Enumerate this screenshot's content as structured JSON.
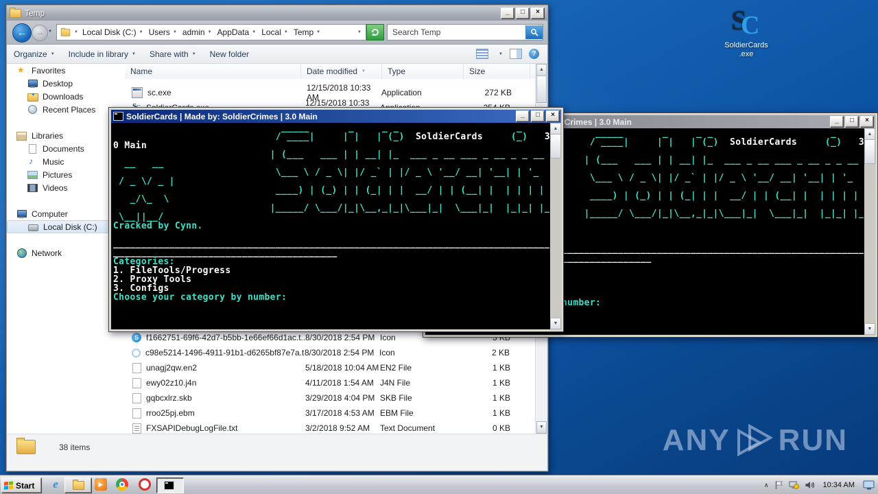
{
  "chrome": {
    "minimize": "_",
    "maximize": "□",
    "close": "×"
  },
  "desktop": {
    "icon": {
      "line1": "SoldierCards",
      "line2": ".exe",
      "logo_s": "S",
      "logo_c": "C"
    },
    "watermark": {
      "left": "ANY",
      "right": "RUN"
    }
  },
  "explorer": {
    "title": "Temp",
    "nav": {
      "back": "←",
      "forward": "→",
      "dropdown": "▼",
      "search_placeholder": "Search Temp"
    },
    "breadcrumb": [
      {
        "label": "Local Disk (C:)",
        "sep": "▼"
      },
      {
        "label": "Users",
        "sep": "▼"
      },
      {
        "label": "admin",
        "sep": "▼"
      },
      {
        "label": "AppData",
        "sep": "▼"
      },
      {
        "label": "Local",
        "sep": "▼"
      },
      {
        "label": "Temp",
        "sep": "▼"
      }
    ],
    "toolbar": [
      {
        "label": "Organize",
        "caret": "▼"
      },
      {
        "label": "Include in library",
        "caret": "▼"
      },
      {
        "label": "Share with",
        "caret": "▼"
      },
      {
        "label": "New folder",
        "caret": ""
      }
    ],
    "columns": [
      {
        "label": "Name",
        "sort": "",
        "cls": "c-name"
      },
      {
        "label": "Date modified",
        "sort": "▼",
        "cls": "c-date"
      },
      {
        "label": "Type",
        "sort": "",
        "cls": "c-type"
      },
      {
        "label": "Size",
        "sort": "",
        "cls": "c-size"
      }
    ],
    "sidebar": [
      {
        "label": "Favorites",
        "icon": "s-star",
        "lv": "lv0",
        "gap": ""
      },
      {
        "label": "Desktop",
        "icon": "s-monitor",
        "lv": "lv1",
        "gap": ""
      },
      {
        "label": "Downloads",
        "icon": "s-down",
        "lv": "lv1",
        "gap": ""
      },
      {
        "label": "Recent Places",
        "icon": "s-recent",
        "lv": "lv1",
        "gap": ""
      },
      {
        "label": "Libraries",
        "icon": "s-lib",
        "lv": "lv0",
        "gap": "gap"
      },
      {
        "label": "Documents",
        "icon": "s-doc",
        "lv": "lv1",
        "gap": ""
      },
      {
        "label": "Music",
        "icon": "s-music",
        "lv": "lv1",
        "gap": ""
      },
      {
        "label": "Pictures",
        "icon": "s-pic",
        "lv": "lv1",
        "gap": ""
      },
      {
        "label": "Videos",
        "icon": "s-video",
        "lv": "lv1",
        "gap": ""
      },
      {
        "label": "Computer",
        "icon": "s-computer",
        "lv": "lv0",
        "gap": "gap"
      },
      {
        "label": "Local Disk (C:)",
        "icon": "s-disk",
        "lv": "lv1",
        "gap": "",
        "sel": true
      },
      {
        "label": "Network",
        "icon": "s-network",
        "lv": "lv0",
        "gap": "gap"
      }
    ],
    "files_top": [
      {
        "icon": "i-app",
        "name": "sc.exe",
        "date": "12/15/2018 10:33 AM",
        "type": "Application",
        "size": "272 KB"
      },
      {
        "icon": "i-sc",
        "name": "SoldierCards.exe",
        "date": "12/15/2018 10:33 AM",
        "type": "Application",
        "size": "254 KB"
      }
    ],
    "files_bottom": [
      {
        "icon": "i-skype",
        "name": "f1662751-69f6-42d7-b5bb-1e66ef66d1ac.t...",
        "date": "8/30/2018 2:54 PM",
        "type": "Icon",
        "size": "3 KB"
      },
      {
        "icon": "i-ring",
        "name": "c98e5214-1496-4911-91b1-d6265bf87e7a.t...",
        "date": "8/30/2018 2:54 PM",
        "type": "Icon",
        "size": "2 KB"
      },
      {
        "icon": "i-file",
        "name": "unagj2qw.en2",
        "date": "5/18/2018 10:04 AM",
        "type": "EN2 File",
        "size": "1 KB"
      },
      {
        "icon": "i-file",
        "name": "ewy02z10.j4n",
        "date": "4/11/2018 1:54 AM",
        "type": "J4N File",
        "size": "1 KB"
      },
      {
        "icon": "i-file",
        "name": "gqbcxlrz.skb",
        "date": "3/29/2018 4:04 PM",
        "type": "SKB File",
        "size": "1 KB"
      },
      {
        "icon": "i-file",
        "name": "rroo25pj.ebm",
        "date": "3/17/2018 4:53 AM",
        "type": "EBM File",
        "size": "1 KB"
      },
      {
        "icon": "i-txt",
        "name": "FXSAPIDebugLogFile.txt",
        "date": "3/2/2018 9:52 AM",
        "type": "Text Document",
        "size": "0 KB"
      }
    ],
    "status": "38 items"
  },
  "console": {
    "title": "SoldierCards | Made by: SoldierCrimes | 3.0 Main",
    "colors": {
      "cyan": "#3fe0c9",
      "white": "#ffffff"
    },
    "segments": [
      {
        "c": "c",
        "t": "                              _____       _     _ _                     _\n                             / ____|     | |   | (_)"
      },
      {
        "c": "w",
        "t": "  SoldierCards"
      },
      {
        "c": "c",
        "t": "     (_)"
      },
      {
        "c": "w",
        "t": "   3."
      },
      {
        "c": "w",
        "t": "\n0 Main"
      },
      {
        "c": "c",
        "t": "\n                            | (___   ___ | | __| |_  ___ _ __ ___ _ __ _ _ __ \n  __   __\n                             \\___ \\ / _ \\| |/ _` | |/ _ \\ '__/ __| '__| | '_ \n / _ \\/ _ |\n                             ____) | (_) | | (_| | |  __/ | | (__| |  | | | | \n   _/\\_  \\\n                            |_____/ \\___/|_|\\__,_|_|\\___|_|  \\___|_|  |_|_| |_\n \\__||__/\nCracked by Cynn.\n\n"
      },
      {
        "c": "w",
        "t": "______________________________________________________________________________\n________________________________________\n"
      },
      {
        "c": "c",
        "t": "Categories:\n"
      },
      {
        "c": "w",
        "t": "1. FileTools/Progress\n2. Proxy Tools\n3. Configs\n"
      },
      {
        "c": "c",
        "t": "Choose your category by number:"
      }
    ]
  },
  "taskbar": {
    "start": "Start",
    "clock": "10:34 AM"
  }
}
